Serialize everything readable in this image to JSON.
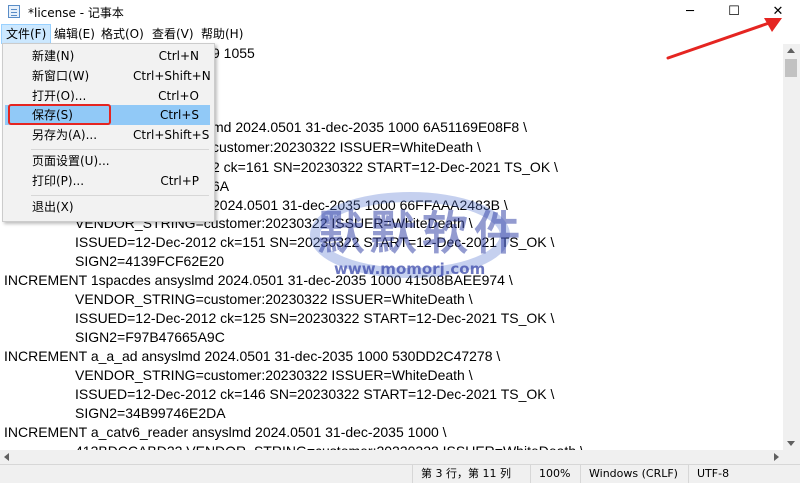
{
  "window": {
    "title": "*license - 记事本",
    "minimize_glyph": "─",
    "maximize_glyph": "☐",
    "close_glyph": "✕"
  },
  "menubar": {
    "items": [
      "文件(F)",
      "编辑(E)",
      "格式(O)",
      "查看(V)",
      "帮助(H)"
    ]
  },
  "file_menu": {
    "items": [
      {
        "label": "新建(N)",
        "shortcut": "Ctrl+N"
      },
      {
        "label": "新窗口(W)",
        "shortcut": "Ctrl+Shift+N"
      },
      {
        "label": "打开(O)...",
        "shortcut": "Ctrl+O"
      },
      {
        "label": "保存(S)",
        "shortcut": "Ctrl+S"
      },
      {
        "label": "另存为(A)...",
        "shortcut": "Ctrl+Shift+S"
      },
      {
        "label": "页面设置(U)...",
        "shortcut": ""
      },
      {
        "label": "打印(P)...",
        "shortcut": "Ctrl+P"
      },
      {
        "label": "退出(X)",
        "shortcut": ""
      }
    ],
    "highlighted_item": "保存(S)"
  },
  "editor": {
    "lines": [
      "9 1055",
      "",
      "",
      "",
      "md 2024.0501 31-dec-2035 1000 6A51169E08F8 \\",
      "customer:20230322 ISSUER=WhiteDeath \\",
      "2 ck=161 SN=20230322 START=12-Dec-2021 TS_OK \\",
      "6A",
      "2024.0501 31-dec-2035 1000 66FFAAA2483B \\",
      "VENDOR_STRING=customer:20230322 ISSUER=WhiteDeath \\",
      "ISSUED=12-Dec-2012 ck=151 SN=20230322 START=12-Dec-2021 TS_OK \\",
      "SIGN2=4139FCF62E20",
      "INCREMENT 1spacdes ansyslmd 2024.0501 31-dec-2035 1000 41508BAEE974 \\",
      "VENDOR_STRING=customer:20230322 ISSUER=WhiteDeath \\",
      "ISSUED=12-Dec-2012 ck=125 SN=20230322 START=12-Dec-2021 TS_OK \\",
      "SIGN2=F97B47665A9C",
      "INCREMENT a_a_ad ansyslmd 2024.0501 31-dec-2035 1000 530DD2C47278 \\",
      "VENDOR_STRING=customer:20230322 ISSUER=WhiteDeath \\",
      "ISSUED=12-Dec-2012 ck=146 SN=20230322 START=12-Dec-2021 TS_OK \\",
      "SIGN2=34B99746E2DA",
      "INCREMENT a_catv6_reader ansyslmd 2024.0501 31-dec-2035 1000 \\",
      "413BDCCABD22 VENDOR_STRING=customer:20230322 ISSUER=WhiteDeath \\"
    ]
  },
  "statusbar": {
    "position": "第 3 行，第 11 列",
    "zoom": "100%",
    "line_ending": "Windows (CRLF)",
    "encoding": "UTF-8"
  },
  "watermark": {
    "text": "默默软件",
    "url": "www.momorj.com"
  },
  "colors": {
    "highlight": "#91c9f7",
    "annotation_red": "#e52521"
  }
}
